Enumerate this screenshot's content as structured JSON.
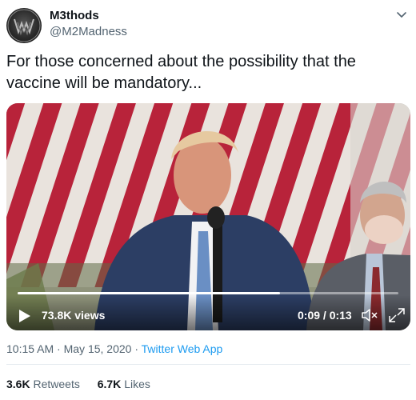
{
  "author": {
    "display_name": "M3thods",
    "handle": "@M2Madness",
    "avatar_icon": "wm-logo-avatar"
  },
  "tweet": {
    "text": "For those concerned about the possibility that the vaccine will be mandatory..."
  },
  "video": {
    "views": "73.8K views",
    "time": "0:09 / 0:13",
    "progress": 0.69,
    "play_icon": "play-icon",
    "mute_icon": "muted-speaker-icon",
    "expand_icon": "expand-icon"
  },
  "meta": {
    "time": "10:15 AM",
    "separator": " · ",
    "date": "May 15, 2020",
    "source": "Twitter Web App"
  },
  "stats": {
    "retweets_count": "3.6K",
    "retweets_label": "Retweets",
    "likes_count": "6.7K",
    "likes_label": "Likes"
  },
  "colors": {
    "text": "#0f1419",
    "secondary": "#536471",
    "link": "#1d9bf0"
  }
}
